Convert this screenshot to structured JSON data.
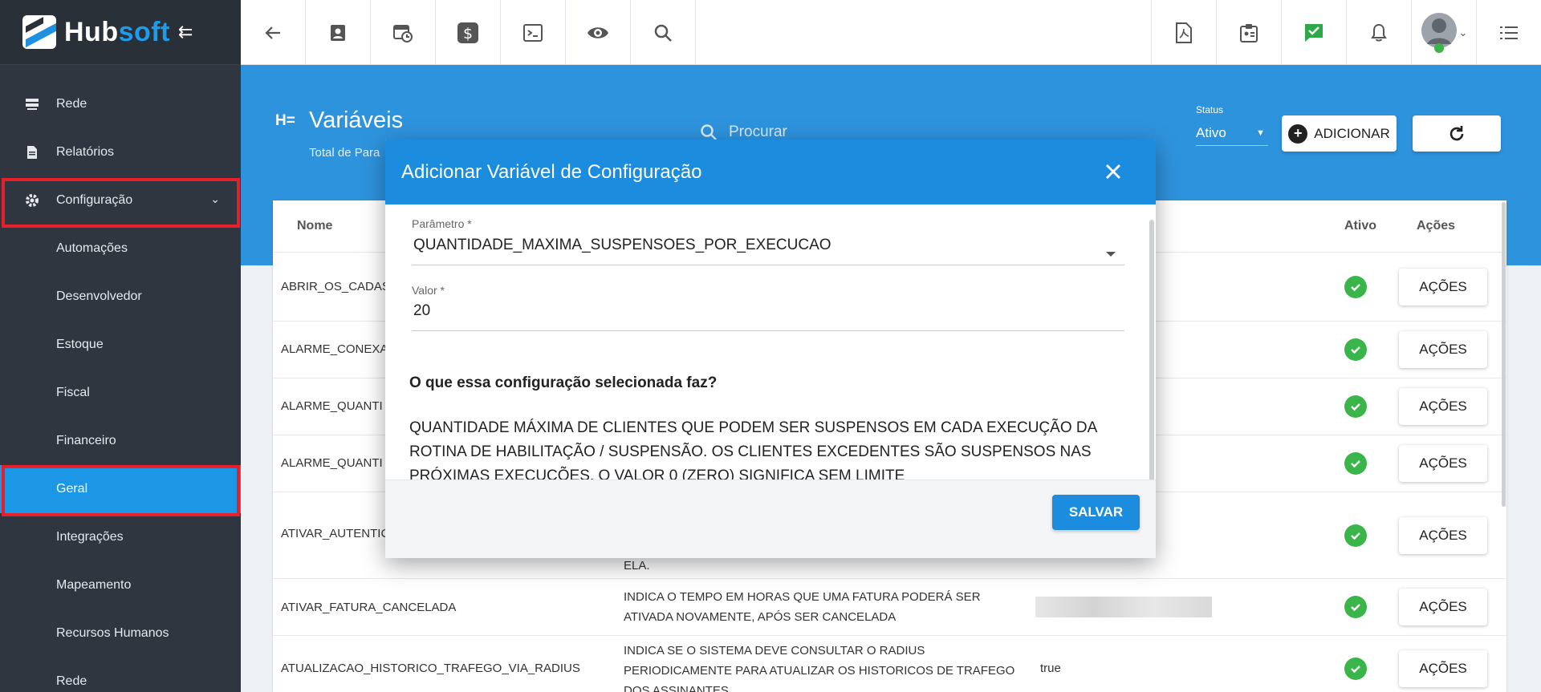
{
  "brand": {
    "hub": "Hub",
    "soft": "soft"
  },
  "sidebar": {
    "items": [
      {
        "label": "Rede",
        "icon": "server-icon"
      },
      {
        "label": "Relatórios",
        "icon": "document-icon"
      },
      {
        "label": "Configuração",
        "icon": "gear-icon"
      },
      {
        "label": "Automações"
      },
      {
        "label": "Desenvolvedor"
      },
      {
        "label": "Estoque"
      },
      {
        "label": "Fiscal"
      },
      {
        "label": "Financeiro"
      },
      {
        "label": "Geral"
      },
      {
        "label": "Integrações"
      },
      {
        "label": "Mapeamento"
      },
      {
        "label": "Recursos Humanos"
      },
      {
        "label": "Rede"
      }
    ],
    "active": "Geral"
  },
  "header": {
    "title": "Variáveis",
    "subtitle": "Total de Para",
    "search_placeholder": "Procurar",
    "status_label": "Status",
    "status_value": "Ativo",
    "add_label": "ADICIONAR"
  },
  "table": {
    "columns": {
      "nome": "Nome",
      "ativo": "Ativo",
      "acoes": "Ações"
    },
    "action_label": "AÇÕES",
    "rows": [
      {
        "name": "ABRIR_OS_CADAS",
        "desc": "",
        "value": ""
      },
      {
        "name": "ALARME_CONEXA",
        "desc": "",
        "value": ""
      },
      {
        "name": "ALARME_QUANTI",
        "desc": "",
        "value": ""
      },
      {
        "name": "ALARME_QUANTI",
        "desc": "",
        "value": ""
      },
      {
        "name": "ATIVAR_AUTENTIC",
        "desc": "ELA.",
        "value": ""
      },
      {
        "name": "ATIVAR_FATURA_CANCELADA",
        "desc": "INDICA O TEMPO EM HORAS QUE UMA FATURA PODERÁ SER ATIVADA NOVAMENTE, APÓS SER CANCELADA",
        "value": ""
      },
      {
        "name": "ATUALIZACAO_HISTORICO_TRAFEGO_VIA_RADIUS",
        "desc": "INDICA SE O SISTEMA DEVE CONSULTAR O RADIUS PERIODICAMENTE PARA ATUALIZAR OS HISTORICOS DE TRAFEGO DOS ASSINANTES",
        "value": "true"
      }
    ]
  },
  "dialog": {
    "title": "Adicionar Variável de Configuração",
    "param_label": "Parâmetro",
    "param_value": "QUANTIDADE_MAXIMA_SUSPENSOES_POR_EXECUCAO",
    "value_label": "Valor",
    "value_value": "20",
    "required_mark": "*",
    "what_title": "O que essa configuração selecionada faz?",
    "what_text": "QUANTIDADE MÁXIMA DE CLIENTES QUE PODEM SER SUSPENSOS EM CADA EXECUÇÃO DA ROTINA DE HABILITAÇÃO / SUSPENSÃO. OS CLIENTES EXCEDENTES SÃO SUSPENSOS NAS PRÓXIMAS EXECUÇÕES. O VALOR 0 (ZERO) SIGNIFICA SEM LIMITE",
    "save_label": "SALVAR"
  },
  "colors": {
    "accent": "#1b8cde",
    "sidebar": "#2f3640",
    "active": "#1b97e6",
    "ok": "#3ab54a",
    "highlight": "#e5202a"
  }
}
